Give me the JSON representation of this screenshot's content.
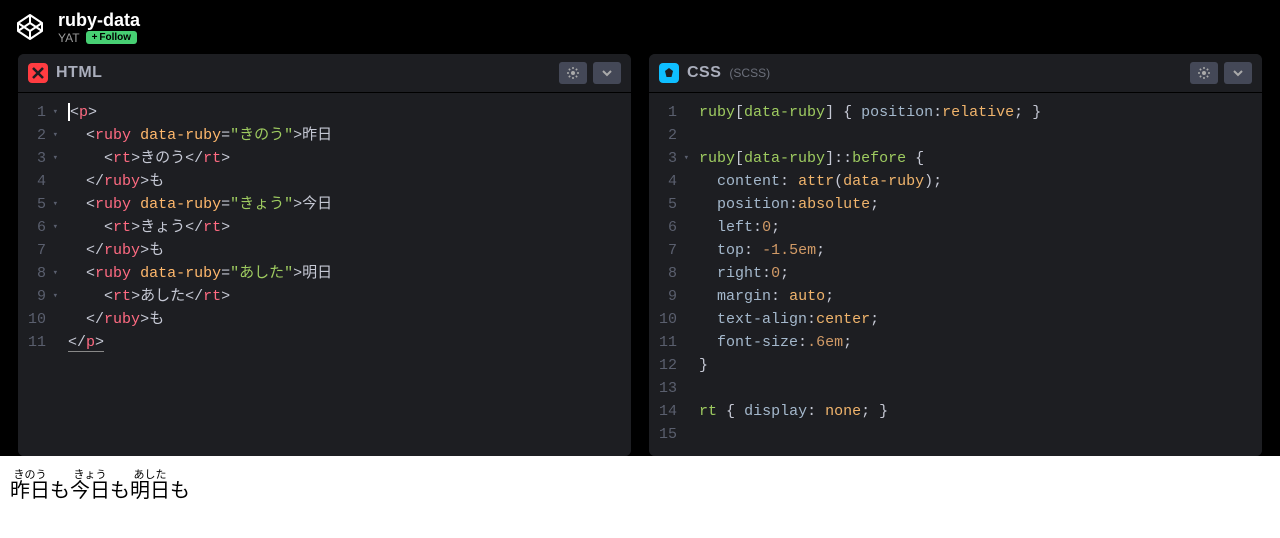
{
  "header": {
    "title": "ruby-data",
    "author": "YAT",
    "follow_label": "Follow"
  },
  "panels": {
    "html": {
      "label": "HTML",
      "sub": "",
      "lines": [
        {
          "n": "1",
          "fold": true,
          "html": "<span class='t-punc'>&lt;</span><span class='t-tag'>p</span><span class='t-punc'>&gt;</span>",
          "cursor": true
        },
        {
          "n": "2",
          "fold": true,
          "html": "  <span class='t-punc'>&lt;</span><span class='t-tag'>ruby</span> <span class='t-attr'>data-ruby</span><span class='t-punc'>=</span><span class='t-str'>\"きのう\"</span><span class='t-punc'>&gt;</span><span class='t-txt'>昨日</span>"
        },
        {
          "n": "3",
          "fold": true,
          "html": "    <span class='t-punc'>&lt;</span><span class='t-tag'>rt</span><span class='t-punc'>&gt;</span><span class='t-txt'>きのう</span><span class='t-punc'>&lt;/</span><span class='t-tag'>rt</span><span class='t-punc'>&gt;</span>"
        },
        {
          "n": "4",
          "fold": false,
          "html": "  <span class='t-punc'>&lt;/</span><span class='t-tag'>ruby</span><span class='t-punc'>&gt;</span><span class='t-txt'>も</span>"
        },
        {
          "n": "5",
          "fold": true,
          "html": "  <span class='t-punc'>&lt;</span><span class='t-tag'>ruby</span> <span class='t-attr'>data-ruby</span><span class='t-punc'>=</span><span class='t-str'>\"きょう\"</span><span class='t-punc'>&gt;</span><span class='t-txt'>今日</span>"
        },
        {
          "n": "6",
          "fold": true,
          "html": "    <span class='t-punc'>&lt;</span><span class='t-tag'>rt</span><span class='t-punc'>&gt;</span><span class='t-txt'>きょう</span><span class='t-punc'>&lt;/</span><span class='t-tag'>rt</span><span class='t-punc'>&gt;</span>"
        },
        {
          "n": "7",
          "fold": false,
          "html": "  <span class='t-punc'>&lt;/</span><span class='t-tag'>ruby</span><span class='t-punc'>&gt;</span><span class='t-txt'>も</span>"
        },
        {
          "n": "8",
          "fold": true,
          "html": "  <span class='t-punc'>&lt;</span><span class='t-tag'>ruby</span> <span class='t-attr'>data-ruby</span><span class='t-punc'>=</span><span class='t-str'>\"あした\"</span><span class='t-punc'>&gt;</span><span class='t-txt'>明日</span>"
        },
        {
          "n": "9",
          "fold": true,
          "html": "    <span class='t-punc'>&lt;</span><span class='t-tag'>rt</span><span class='t-punc'>&gt;</span><span class='t-txt'>あした</span><span class='t-punc'>&lt;/</span><span class='t-tag'>rt</span><span class='t-punc'>&gt;</span>"
        },
        {
          "n": "10",
          "fold": false,
          "html": "  <span class='t-punc'>&lt;/</span><span class='t-tag'>ruby</span><span class='t-punc'>&gt;</span><span class='t-txt'>も</span>"
        },
        {
          "n": "11",
          "fold": false,
          "html": "<span class='underline'><span class='t-punc'>&lt;/</span><span class='t-tag'>p</span><span class='t-punc'>&gt;</span></span>"
        }
      ]
    },
    "css": {
      "label": "CSS",
      "sub": "(SCSS)",
      "lines": [
        {
          "n": "1",
          "fold": false,
          "html": "<span class='t-sel'>ruby</span><span class='t-punc'>[</span><span class='t-sel'>data-ruby</span><span class='t-punc'>]</span> <span class='t-punc'>{</span> <span class='t-prop'>position</span><span class='t-punc'>:</span><span class='t-val'>relative</span><span class='t-punc'>;</span> <span class='t-punc'>}</span>"
        },
        {
          "n": "2",
          "fold": false,
          "html": ""
        },
        {
          "n": "3",
          "fold": true,
          "html": "<span class='t-sel'>ruby</span><span class='t-punc'>[</span><span class='t-sel'>data-ruby</span><span class='t-punc'>]::</span><span class='t-sel'>before</span> <span class='t-punc'>{</span>"
        },
        {
          "n": "4",
          "fold": false,
          "html": "  <span class='t-prop'>content</span><span class='t-punc'>:</span> <span class='t-val'>attr</span><span class='t-punc'>(</span><span class='t-val'>data-ruby</span><span class='t-punc'>);</span>"
        },
        {
          "n": "5",
          "fold": false,
          "html": "  <span class='t-prop'>position</span><span class='t-punc'>:</span><span class='t-val'>absolute</span><span class='t-punc'>;</span>"
        },
        {
          "n": "6",
          "fold": false,
          "html": "  <span class='t-prop'>left</span><span class='t-punc'>:</span><span class='t-num'>0</span><span class='t-punc'>;</span>"
        },
        {
          "n": "7",
          "fold": false,
          "html": "  <span class='t-prop'>top</span><span class='t-punc'>:</span> <span class='t-num'>-1.5em</span><span class='t-punc'>;</span>"
        },
        {
          "n": "8",
          "fold": false,
          "html": "  <span class='t-prop'>right</span><span class='t-punc'>:</span><span class='t-num'>0</span><span class='t-punc'>;</span>"
        },
        {
          "n": "9",
          "fold": false,
          "html": "  <span class='t-prop'>margin</span><span class='t-punc'>:</span> <span class='t-val'>auto</span><span class='t-punc'>;</span>"
        },
        {
          "n": "10",
          "fold": false,
          "html": "  <span class='t-prop'>text-align</span><span class='t-punc'>:</span><span class='t-val'>center</span><span class='t-punc'>;</span>"
        },
        {
          "n": "11",
          "fold": false,
          "html": "  <span class='t-prop'>font-size</span><span class='t-punc'>:</span><span class='t-num'>.6em</span><span class='t-punc'>;</span>"
        },
        {
          "n": "12",
          "fold": false,
          "html": "<span class='t-punc'>}</span>"
        },
        {
          "n": "13",
          "fold": false,
          "html": ""
        },
        {
          "n": "14",
          "fold": false,
          "html": "<span class='t-sel'>rt</span> <span class='t-punc'>{</span> <span class='t-prop'>display</span><span class='t-punc'>:</span> <span class='t-val'>none</span><span class='t-punc'>;</span> <span class='t-punc'>}</span>"
        },
        {
          "n": "15",
          "fold": false,
          "html": ""
        }
      ]
    }
  },
  "preview": {
    "items": [
      {
        "ruby": "きのう",
        "base": "昨日",
        "rt": "きのう",
        "tail": "も"
      },
      {
        "ruby": "きょう",
        "base": "今日",
        "rt": "きょう",
        "tail": "も"
      },
      {
        "ruby": "あした",
        "base": "明日",
        "rt": "あした",
        "tail": "も"
      }
    ]
  }
}
